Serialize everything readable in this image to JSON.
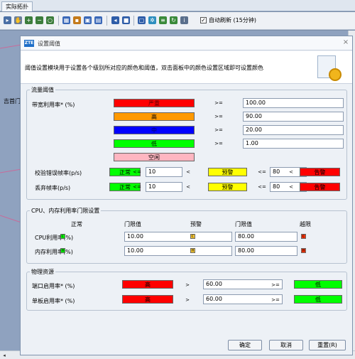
{
  "app": {
    "tab_label": "实际拓扑",
    "auto_refresh_label": "自动刷新 (15分钟)",
    "auto_refresh_checked": true,
    "canvas_label": "吉首门"
  },
  "dialog": {
    "title": "设置阈值",
    "logo_text": "ZTE",
    "description": "阈值设置模块用于设置各个级别所对应的颜色和阈值，双击面板中的颜色设置区域即可设置颜色",
    "flow": {
      "legend": "流量阈值",
      "label": "带宽利用率* (%)",
      "levels": [
        {
          "text": "严重",
          "color": "#ff0000",
          "op": ">=",
          "value": "100.00"
        },
        {
          "text": "高",
          "color": "#ff9900",
          "op": ">=",
          "value": "90.00"
        },
        {
          "text": "中",
          "color": "#0000ff",
          "op": ">=",
          "value": "20.00"
        },
        {
          "text": "低",
          "color": "#00ff00",
          "op": ">=",
          "value": "1.00"
        },
        {
          "text": "空闲",
          "color": "#ffb6c1"
        }
      ],
      "rows": [
        {
          "label": "校验错误帧率(p/s)",
          "normal": "正常",
          "op1": "<=",
          "v1": "10",
          "op2": "<",
          "warn": "预警",
          "op3": "<=",
          "v2": "80",
          "op4": "<",
          "crit": "告警"
        },
        {
          "label": "丢弃帧率(p/s)",
          "normal": "正常",
          "op1": "<=",
          "v1": "10",
          "op2": "<",
          "warn": "预警",
          "op3": "<=",
          "v2": "80",
          "op4": "<",
          "crit": "告警"
        }
      ]
    },
    "cpu": {
      "legend": "CPU、内存利用率门限设置",
      "headers": [
        "正常",
        "门限值",
        "预警",
        "门限值",
        "越限"
      ],
      "rows": [
        {
          "label": "CPU利用率(%)",
          "badge": "C",
          "v1": "10.00",
          "v2": "80.00"
        },
        {
          "label": "内存利用率(%)",
          "badge": "H",
          "v1": "10.00",
          "v2": "80.00"
        }
      ]
    },
    "phys": {
      "legend": "物理资源",
      "rows": [
        {
          "label": "端口启用率* (%)",
          "high": "高",
          "op1": ">",
          "value": "60.00",
          "op2": ">=",
          "low": "低"
        },
        {
          "label": "单板启用率* (%)",
          "high": "高",
          "op1": ">",
          "value": "60.00",
          "op2": ">=",
          "low": "低"
        }
      ]
    },
    "buttons": {
      "ok": "确定",
      "cancel": "取消",
      "reset": "重置(R)"
    }
  },
  "colors": {
    "normal": "#00ff00",
    "warn": "#ffff00",
    "crit": "#ff0000"
  }
}
